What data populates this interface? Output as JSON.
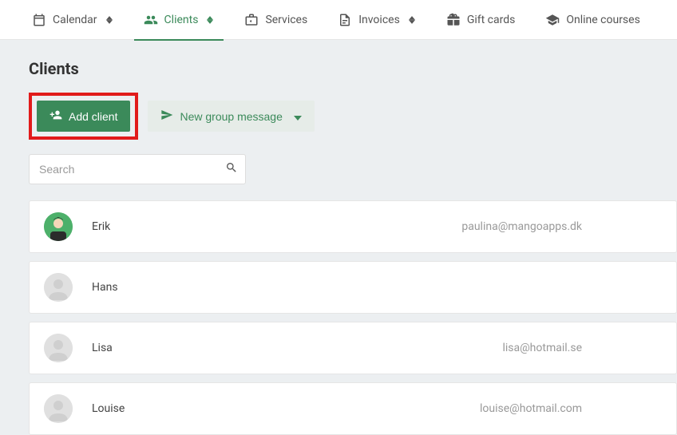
{
  "nav": {
    "items": [
      {
        "label": "Calendar",
        "has_updown": true
      },
      {
        "label": "Clients",
        "has_updown": true,
        "active": true
      },
      {
        "label": "Services",
        "has_updown": false
      },
      {
        "label": "Invoices",
        "has_updown": true
      },
      {
        "label": "Gift cards",
        "has_updown": false
      },
      {
        "label": "Online courses",
        "has_updown": false
      }
    ]
  },
  "page": {
    "title": "Clients"
  },
  "actions": {
    "add_client_label": "Add client",
    "new_group_message_label": "New group message"
  },
  "search": {
    "placeholder": "Search"
  },
  "clients": [
    {
      "name": "Erik",
      "email": "paulina@mangoapps.dk",
      "avatar": "erik"
    },
    {
      "name": "Hans",
      "email": "",
      "avatar": "blank"
    },
    {
      "name": "Lisa",
      "email": "lisa@hotmail.se",
      "avatar": "blank"
    },
    {
      "name": "Louise",
      "email": "louise@hotmail.com",
      "avatar": "blank"
    }
  ]
}
